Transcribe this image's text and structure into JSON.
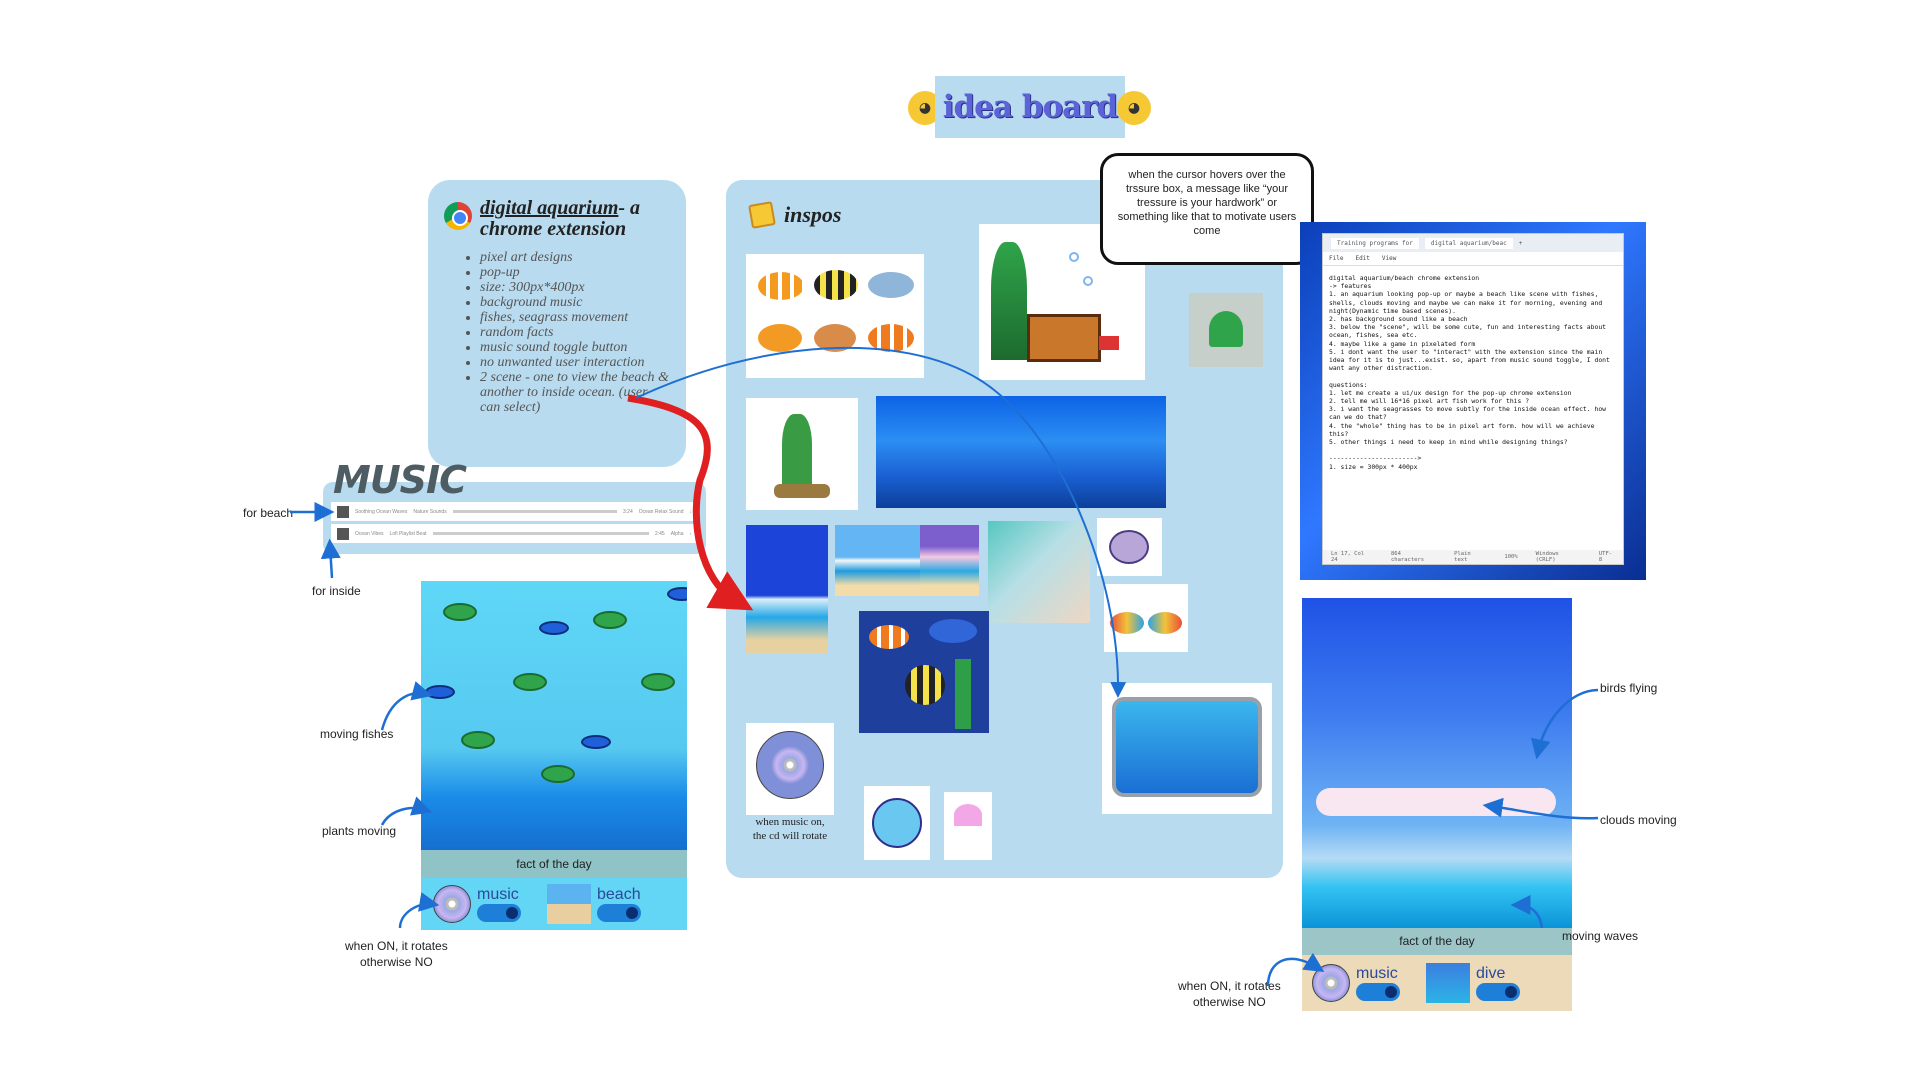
{
  "board": {
    "title": "idea board",
    "emoji_icon": "nerd-face-icon"
  },
  "note": {
    "title_underlined": "digital aquarium",
    "title_rest": "- a chrome extension",
    "items": [
      "pixel art designs",
      "pop-up",
      "size: 300px*400px",
      "background music",
      "fishes, seagrass movement",
      "random facts",
      "music sound toggle button",
      "no unwanted user interaction",
      "2 scene - one to view the beach & another to inside ocean. (user can select)"
    ]
  },
  "music": {
    "title": "MUSIC",
    "tracks": [
      {
        "name": "Soothing Ocean Waves",
        "sub": "Nature Sounds",
        "time": "3:24",
        "album": "Ocean Relax Sound"
      },
      {
        "name": "Ocean Vibes",
        "sub": "Lofi Playlist Beat",
        "time": "2:45",
        "album": "Alpha"
      }
    ],
    "label_beach": "for beach",
    "label_inside": "for inside"
  },
  "phone_inside": {
    "fact": "fact of the day",
    "music_label": "music",
    "beach_label": "beach",
    "ann_fishes": "moving fishes",
    "ann_plants": "plants moving",
    "ann_rotate": "when ON, it rotates\notherwise NO"
  },
  "inspos": {
    "title": "inspos",
    "cd_caption": "when music on,\nthe cd will rotate"
  },
  "bubble": {
    "text": "when the cursor hovers over the trssure box, a message like “your tressure is your hardwork” or something like that to motivate users come"
  },
  "notepad": {
    "tab1": "Training programs for",
    "tab2": "digital aquarium/beac",
    "menu": [
      "File",
      "Edit",
      "View"
    ],
    "body": "digital aquarium/beach chrome extension\n-> features\n1. an aquarium looking pop-up or maybe a beach like scene with fishes, shells, clouds moving and maybe we can make it for morning, evening and night(Dynamic time based scenes).\n2. has background sound like a beach\n3. below the \"scene\", will be some cute, fun and interesting facts about ocean, fishes, sea etc.\n4. maybe like a game in pixelated form\n5. i dont want the user to \"interact\" with the extension since the main idea for it is to just...exist. so, apart from music sound toggle, I dont want any other distraction.\n\nquestions:\n1. let me create a ui/ux design for the pop-up chrome extension\n2. tell me will 16*16 pixel art fish work for this ?\n3. i want the seagrasses to move subtly for the inside ocean effect. how can we do that?\n4. the \"whole\" thing has to be in pixel art form. how will we achieve this?\n5. other things i need to keep in mind while designing things?\n\n----------------------->\n1. size = 300px * 400px",
    "status": [
      "Ln 17, Col 24",
      "864 characters",
      "Plain text",
      "100%",
      "Windows (CRLF)",
      "UTF-8"
    ]
  },
  "phone_beach": {
    "fact": "fact of the day",
    "music_label": "music",
    "dive_label": "dive",
    "ann_birds": "birds flying",
    "ann_clouds": "clouds moving",
    "ann_waves": "moving waves",
    "ann_rotate": "when ON, it rotates\notherwise NO"
  },
  "colors": {
    "card_bg": "#b9dbf0",
    "title_text": "#5b63d6",
    "arrow_blue": "#1e6fd4",
    "arrow_red": "#e02020"
  }
}
